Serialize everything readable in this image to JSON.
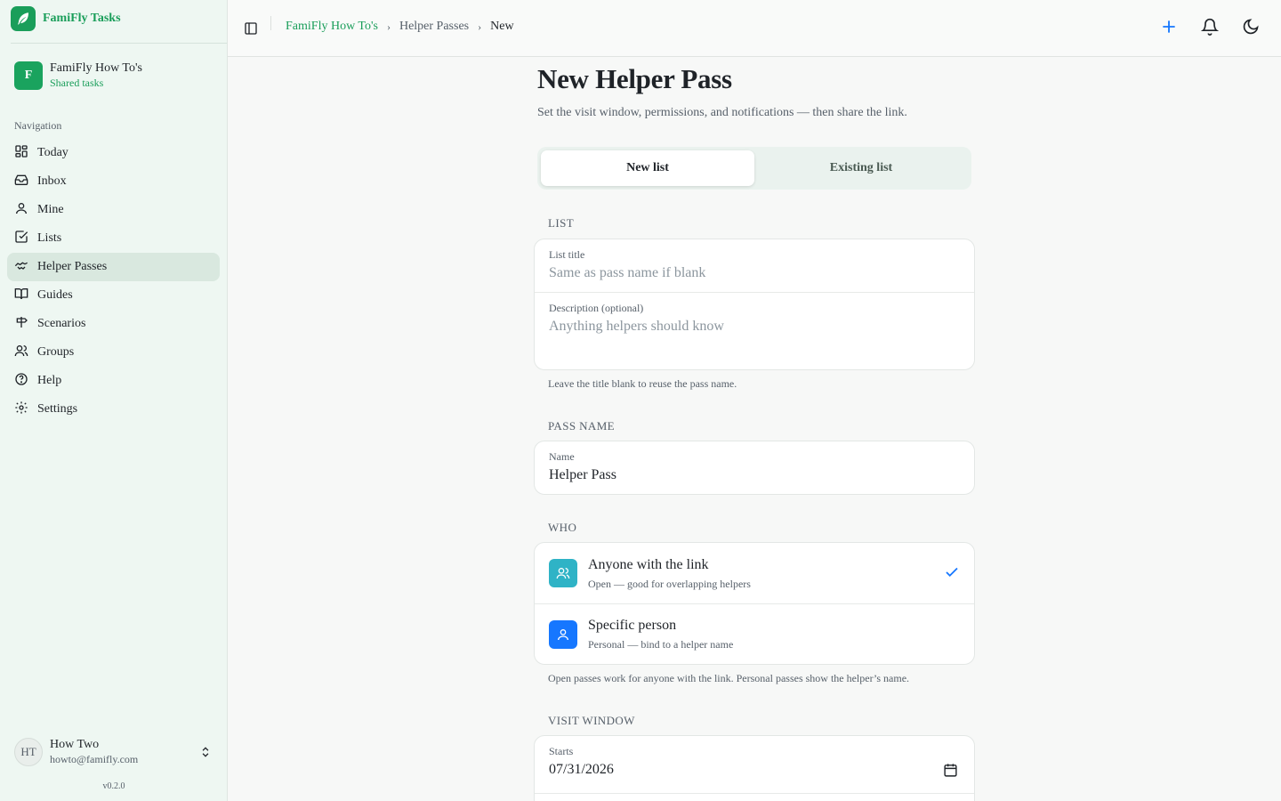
{
  "app": {
    "name": "FamiFly Tasks",
    "version": "v0.2.0"
  },
  "workspace": {
    "initial": "F",
    "title": "FamiFly How To's",
    "subtitle": "Shared tasks"
  },
  "sidebar": {
    "section_label": "Navigation",
    "items": [
      {
        "label": "Today",
        "icon": "grid-icon"
      },
      {
        "label": "Inbox",
        "icon": "inbox-icon"
      },
      {
        "label": "Mine",
        "icon": "user-icon"
      },
      {
        "label": "Lists",
        "icon": "checkbox-icon"
      },
      {
        "label": "Helper Passes",
        "icon": "handshake-icon",
        "active": true
      },
      {
        "label": "Guides",
        "icon": "book-icon"
      },
      {
        "label": "Scenarios",
        "icon": "signpost-icon"
      },
      {
        "label": "Groups",
        "icon": "users-icon"
      },
      {
        "label": "Help",
        "icon": "help-circle-icon"
      },
      {
        "label": "Settings",
        "icon": "gear-icon"
      }
    ]
  },
  "user": {
    "initials": "HT",
    "name": "How Two",
    "email": "howto@famifly.com"
  },
  "header": {
    "breadcrumb": [
      "FamiFly How To's",
      "Helper Passes",
      "New"
    ]
  },
  "page": {
    "title": "New Helper Pass",
    "subtitle": "Set the visit window, permissions, and notifications — then share the link."
  },
  "tabs": [
    {
      "label": "New list",
      "active": true
    },
    {
      "label": "Existing list",
      "active": false
    }
  ],
  "list_section": {
    "label": "List",
    "title_field": {
      "label": "List title",
      "placeholder": "Same as pass name if blank"
    },
    "description_field": {
      "label": "Description (optional)",
      "placeholder": "Anything helpers should know"
    },
    "help": "Leave the title blank to reuse the pass name."
  },
  "pass_name_section": {
    "label": "Pass name",
    "name_field": {
      "label": "Name",
      "value": "Helper Pass"
    }
  },
  "who_section": {
    "label": "Who",
    "options": [
      {
        "title": "Anyone with the link",
        "subtitle": "Open — good for overlapping helpers",
        "selected": true,
        "color": "#2fb3c6"
      },
      {
        "title": "Specific person",
        "subtitle": "Personal — bind to a helper name",
        "selected": false,
        "color": "#1677ff"
      }
    ],
    "help": "Open passes work for anyone with the link. Personal passes show the helper’s name."
  },
  "visit_window_section": {
    "label": "Visit window",
    "starts_field": {
      "label": "Starts",
      "value": "07/31/2026"
    }
  },
  "colors": {
    "brand": "#1a9e5a",
    "accent": "#1677ff"
  }
}
